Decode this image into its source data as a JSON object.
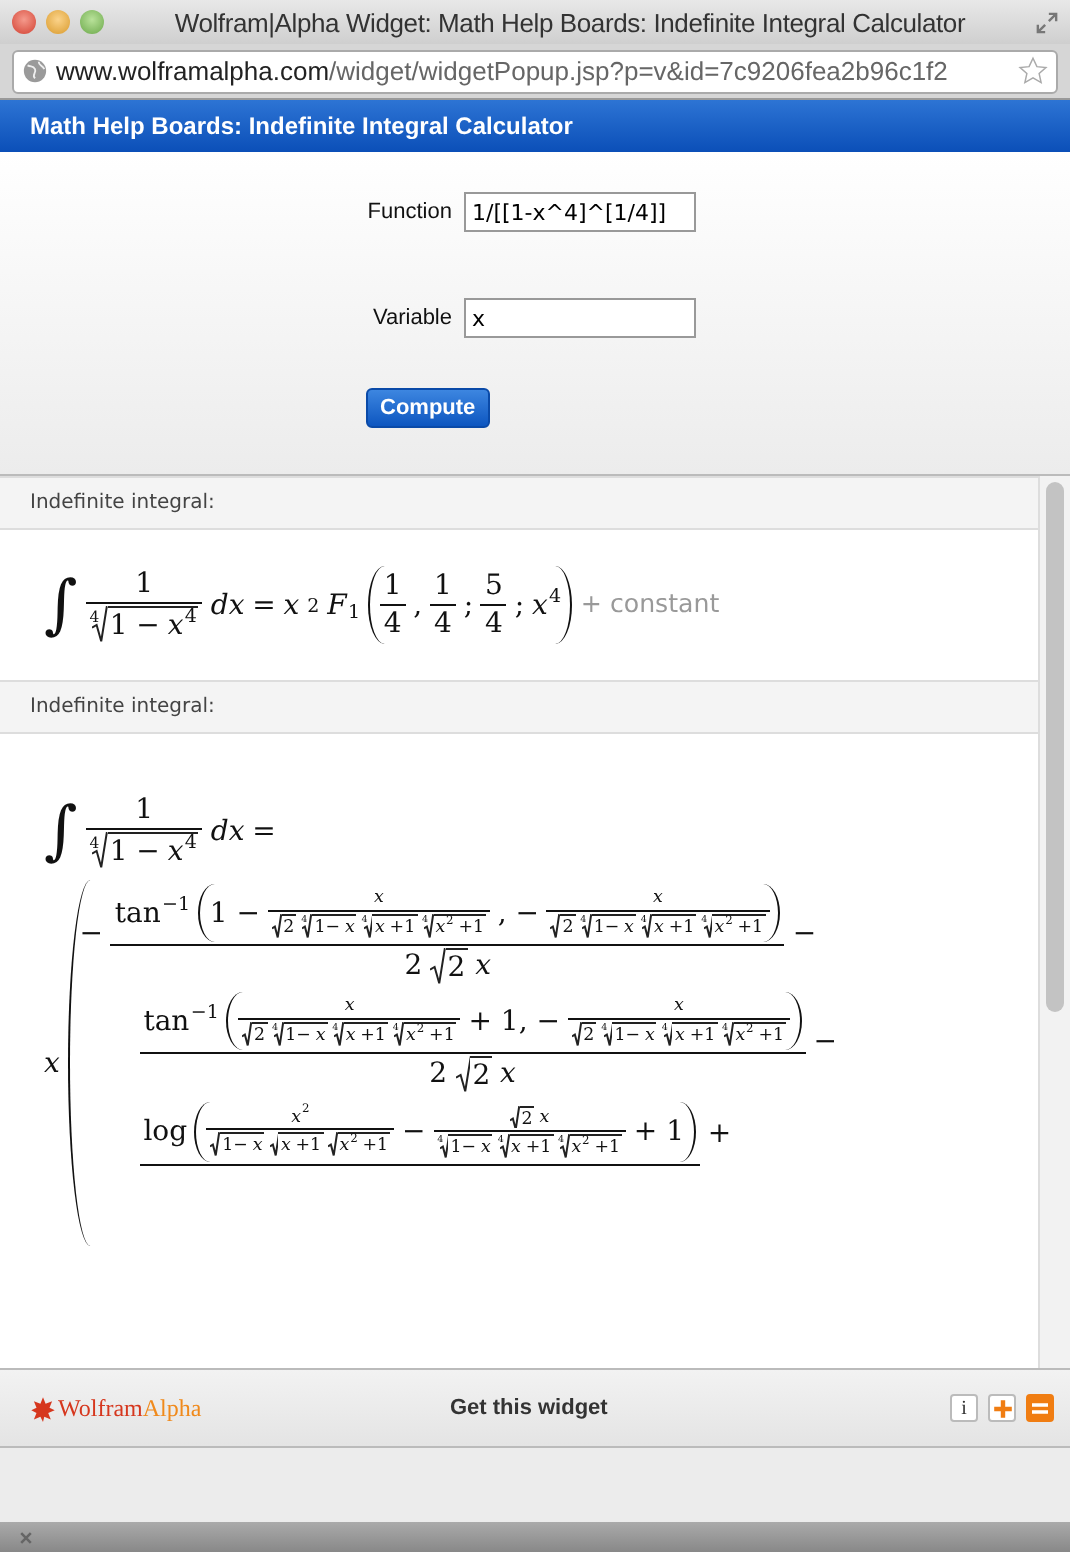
{
  "window": {
    "title": "Wolfram|Alpha Widget: Math Help Boards: Indefinite Integral Calculator"
  },
  "address_bar": {
    "host": "www.wolframalpha.com",
    "path": "/widget/widgetPopup.jsp?p=v&id=7c9206fea2b96c1f2"
  },
  "widget_header": "Math Help Boards: Indefinite Integral Calculator",
  "form": {
    "fields": [
      {
        "label": "Function",
        "value": "1/[[1-x^4]^[1/4]]"
      },
      {
        "label": "Variable",
        "value": "x"
      }
    ],
    "button": "Compute"
  },
  "pods": [
    {
      "title": "Indefinite integral:",
      "lines": [
        {
          "kind": "row",
          "items": [
            {
              "kind": "int",
              "text": "∫"
            },
            {
              "kind": "frac",
              "numerator": {
                "kind": "num",
                "text": "1"
              },
              "denominator": {
                "kind": "root",
                "index": "4",
                "radicand": {
                  "kind": "row",
                  "items": [
                    {
                      "kind": "num",
                      "text": "1 −"
                    },
                    {
                      "kind": "sup",
                      "base": {
                        "kind": "var",
                        "text": "x"
                      },
                      "script": {
                        "kind": "num",
                        "text": "4"
                      }
                    }
                  ]
                }
              }
            },
            {
              "kind": "var",
              "text": "dx"
            },
            {
              "kind": "num",
              "text": "="
            },
            {
              "kind": "var",
              "text": "x"
            },
            {
              "kind": "row",
              "items": [
                {
                  "kind": "sub",
                  "script": {
                    "kind": "num",
                    "text": "2"
                  }
                },
                {
                  "kind": "sub",
                  "base": {
                    "kind": "var",
                    "text": "F"
                  },
                  "script": {
                    "kind": "num",
                    "text": "1"
                  }
                }
              ]
            },
            {
              "kind": "paren",
              "content": {
                "kind": "row",
                "items": [
                  {
                    "kind": "frac",
                    "numerator": {
                      "kind": "num",
                      "text": "1"
                    },
                    "denominator": {
                      "kind": "num",
                      "text": "4"
                    }
                  },
                  {
                    "kind": "num",
                    "text": ","
                  },
                  {
                    "kind": "frac",
                    "numerator": {
                      "kind": "num",
                      "text": "1"
                    },
                    "denominator": {
                      "kind": "num",
                      "text": "4"
                    }
                  },
                  {
                    "kind": "num",
                    "text": ";"
                  },
                  {
                    "kind": "frac",
                    "numerator": {
                      "kind": "num",
                      "text": "5"
                    },
                    "denominator": {
                      "kind": "num",
                      "text": "4"
                    }
                  },
                  {
                    "kind": "num",
                    "text": ";"
                  },
                  {
                    "kind": "sup",
                    "base": {
                      "kind": "var",
                      "text": "x"
                    },
                    "script": {
                      "kind": "num",
                      "text": "4"
                    }
                  }
                ]
              }
            },
            {
              "kind": "note",
              "text": "+ constant"
            }
          ]
        }
      ]
    },
    {
      "title": "Indefinite integral:",
      "lines": [
        {
          "kind": "row",
          "items": [
            {
              "kind": "int",
              "text": "∫"
            },
            {
              "kind": "frac",
              "numerator": {
                "kind": "num",
                "text": "1"
              },
              "denominator": {
                "kind": "root",
                "index": "4",
                "radicand": {
                  "kind": "row",
                  "items": [
                    {
                      "kind": "num",
                      "text": "1 −"
                    },
                    {
                      "kind": "sup",
                      "base": {
                        "kind": "var",
                        "text": "x"
                      },
                      "script": {
                        "kind": "num",
                        "text": "4"
                      }
                    }
                  ]
                }
              }
            },
            {
              "kind": "var",
              "text": "dx"
            },
            {
              "kind": "num",
              "text": "="
            }
          ]
        },
        {
          "kind": "row",
          "items": [
            {
              "kind": "var",
              "text": "x"
            },
            {
              "kind": "open_paren",
              "content": {
                "kind": "col",
                "items": [
                  {
                    "kind": "row",
                    "items": [
                      {
                        "kind": "num",
                        "text": "−"
                      },
                      {
                        "kind": "frac",
                        "numerator": {
                          "kind": "row",
                          "items": [
                            {
                              "kind": "sup",
                              "base": {
                                "kind": "num",
                                "text": "tan"
                              },
                              "script": {
                                "kind": "num",
                                "text": "−1"
                              }
                            },
                            {
                              "kind": "paren",
                              "content": {
                                "kind": "row",
                                "items": [
                                  {
                                    "kind": "num",
                                    "text": "1 −"
                                  },
                                  {
                                    "kind": "frac",
                                    "numerator": {
                                      "kind": "var",
                                      "text": "x"
                                    },
                                    "denominator": {
                                      "kind": "row",
                                      "items": [
                                        {
                                          "kind": "root",
                                          "radicand": {
                                            "kind": "num",
                                            "text": "2"
                                          }
                                        },
                                        {
                                          "kind": "root",
                                          "index": "4",
                                          "radicand": {
                                            "kind": "row",
                                            "items": [
                                              {
                                                "kind": "num",
                                                "text": "1−"
                                              },
                                              {
                                                "kind": "var",
                                                "text": "x"
                                              }
                                            ]
                                          }
                                        },
                                        {
                                          "kind": "root",
                                          "index": "4",
                                          "radicand": {
                                            "kind": "row",
                                            "items": [
                                              {
                                                "kind": "var",
                                                "text": "x"
                                              },
                                              {
                                                "kind": "num",
                                                "text": "+1"
                                              }
                                            ]
                                          }
                                        },
                                        {
                                          "kind": "root",
                                          "index": "4",
                                          "radicand": {
                                            "kind": "row",
                                            "items": [
                                              {
                                                "kind": "sup",
                                                "base": {
                                                  "kind": "var",
                                                  "text": "x"
                                                },
                                                "script": {
                                                  "kind": "num",
                                                  "text": "2"
                                                }
                                              },
                                              {
                                                "kind": "num",
                                                "text": "+1"
                                              }
                                            ]
                                          }
                                        }
                                      ]
                                    }
                                  },
                                  {
                                    "kind": "num",
                                    "text": ", −"
                                  },
                                  {
                                    "kind": "frac",
                                    "numerator": {
                                      "kind": "var",
                                      "text": "x"
                                    },
                                    "denominator": {
                                      "kind": "row",
                                      "items": [
                                        {
                                          "kind": "root",
                                          "radicand": {
                                            "kind": "num",
                                            "text": "2"
                                          }
                                        },
                                        {
                                          "kind": "root",
                                          "index": "4",
                                          "radicand": {
                                            "kind": "row",
                                            "items": [
                                              {
                                                "kind": "num",
                                                "text": "1−"
                                              },
                                              {
                                                "kind": "var",
                                                "text": "x"
                                              }
                                            ]
                                          }
                                        },
                                        {
                                          "kind": "root",
                                          "index": "4",
                                          "radicand": {
                                            "kind": "row",
                                            "items": [
                                              {
                                                "kind": "var",
                                                "text": "x"
                                              },
                                              {
                                                "kind": "num",
                                                "text": "+1"
                                              }
                                            ]
                                          }
                                        },
                                        {
                                          "kind": "root",
                                          "index": "4",
                                          "radicand": {
                                            "kind": "row",
                                            "items": [
                                              {
                                                "kind": "sup",
                                                "base": {
                                                  "kind": "var",
                                                  "text": "x"
                                                },
                                                "script": {
                                                  "kind": "num",
                                                  "text": "2"
                                                }
                                              },
                                              {
                                                "kind": "num",
                                                "text": "+1"
                                              }
                                            ]
                                          }
                                        }
                                      ]
                                    }
                                  }
                                ]
                              }
                            }
                          ]
                        },
                        "denominator": {
                          "kind": "row",
                          "items": [
                            {
                              "kind": "num",
                              "text": "2"
                            },
                            {
                              "kind": "root",
                              "radicand": {
                                "kind": "num",
                                "text": "2"
                              }
                            },
                            {
                              "kind": "var",
                              "text": "x"
                            }
                          ]
                        }
                      },
                      {
                        "kind": "num",
                        "text": "−"
                      }
                    ]
                  },
                  {
                    "kind": "row",
                    "items": [
                      {
                        "kind": "frac",
                        "numerator": {
                          "kind": "row",
                          "items": [
                            {
                              "kind": "sup",
                              "base": {
                                "kind": "num",
                                "text": "tan"
                              },
                              "script": {
                                "kind": "num",
                                "text": "−1"
                              }
                            },
                            {
                              "kind": "paren",
                              "content": {
                                "kind": "row",
                                "items": [
                                  {
                                    "kind": "frac",
                                    "numerator": {
                                      "kind": "var",
                                      "text": "x"
                                    },
                                    "denominator": {
                                      "kind": "row",
                                      "items": [
                                        {
                                          "kind": "root",
                                          "radicand": {
                                            "kind": "num",
                                            "text": "2"
                                          }
                                        },
                                        {
                                          "kind": "root",
                                          "index": "4",
                                          "radicand": {
                                            "kind": "row",
                                            "items": [
                                              {
                                                "kind": "num",
                                                "text": "1−"
                                              },
                                              {
                                                "kind": "var",
                                                "text": "x"
                                              }
                                            ]
                                          }
                                        },
                                        {
                                          "kind": "root",
                                          "index": "4",
                                          "radicand": {
                                            "kind": "row",
                                            "items": [
                                              {
                                                "kind": "var",
                                                "text": "x"
                                              },
                                              {
                                                "kind": "num",
                                                "text": "+1"
                                              }
                                            ]
                                          }
                                        },
                                        {
                                          "kind": "root",
                                          "index": "4",
                                          "radicand": {
                                            "kind": "row",
                                            "items": [
                                              {
                                                "kind": "sup",
                                                "base": {
                                                  "kind": "var",
                                                  "text": "x"
                                                },
                                                "script": {
                                                  "kind": "num",
                                                  "text": "2"
                                                }
                                              },
                                              {
                                                "kind": "num",
                                                "text": "+1"
                                              }
                                            ]
                                          }
                                        }
                                      ]
                                    }
                                  },
                                  {
                                    "kind": "num",
                                    "text": "+ 1, −"
                                  },
                                  {
                                    "kind": "frac",
                                    "numerator": {
                                      "kind": "var",
                                      "text": "x"
                                    },
                                    "denominator": {
                                      "kind": "row",
                                      "items": [
                                        {
                                          "kind": "root",
                                          "radicand": {
                                            "kind": "num",
                                            "text": "2"
                                          }
                                        },
                                        {
                                          "kind": "root",
                                          "index": "4",
                                          "radicand": {
                                            "kind": "row",
                                            "items": [
                                              {
                                                "kind": "num",
                                                "text": "1−"
                                              },
                                              {
                                                "kind": "var",
                                                "text": "x"
                                              }
                                            ]
                                          }
                                        },
                                        {
                                          "kind": "root",
                                          "index": "4",
                                          "radicand": {
                                            "kind": "row",
                                            "items": [
                                              {
                                                "kind": "var",
                                                "text": "x"
                                              },
                                              {
                                                "kind": "num",
                                                "text": "+1"
                                              }
                                            ]
                                          }
                                        },
                                        {
                                          "kind": "root",
                                          "index": "4",
                                          "radicand": {
                                            "kind": "row",
                                            "items": [
                                              {
                                                "kind": "sup",
                                                "base": {
                                                  "kind": "var",
                                                  "text": "x"
                                                },
                                                "script": {
                                                  "kind": "num",
                                                  "text": "2"
                                                }
                                              },
                                              {
                                                "kind": "num",
                                                "text": "+1"
                                              }
                                            ]
                                          }
                                        }
                                      ]
                                    }
                                  }
                                ]
                              }
                            }
                          ]
                        },
                        "denominator": {
                          "kind": "row",
                          "items": [
                            {
                              "kind": "num",
                              "text": "2"
                            },
                            {
                              "kind": "root",
                              "radicand": {
                                "kind": "num",
                                "text": "2"
                              }
                            },
                            {
                              "kind": "var",
                              "text": "x"
                            }
                          ]
                        }
                      },
                      {
                        "kind": "num",
                        "text": "−"
                      }
                    ]
                  },
                  {
                    "kind": "row",
                    "items": [
                      {
                        "kind": "frac",
                        "numerator": {
                          "kind": "row",
                          "items": [
                            {
                              "kind": "num",
                              "text": "log"
                            },
                            {
                              "kind": "paren",
                              "content": {
                                "kind": "row",
                                "items": [
                                  {
                                    "kind": "frac",
                                    "numerator": {
                                      "kind": "sup",
                                      "base": {
                                        "kind": "var",
                                        "text": "x"
                                      },
                                      "script": {
                                        "kind": "num",
                                        "text": "2"
                                      }
                                    },
                                    "denominator": {
                                      "kind": "row",
                                      "items": [
                                        {
                                          "kind": "root",
                                          "radicand": {
                                            "kind": "row",
                                            "items": [
                                              {
                                                "kind": "num",
                                                "text": "1−"
                                              },
                                              {
                                                "kind": "var",
                                                "text": "x"
                                              }
                                            ]
                                          }
                                        },
                                        {
                                          "kind": "root",
                                          "radicand": {
                                            "kind": "row",
                                            "items": [
                                              {
                                                "kind": "var",
                                                "text": "x"
                                              },
                                              {
                                                "kind": "num",
                                                "text": "+1"
                                              }
                                            ]
                                          }
                                        },
                                        {
                                          "kind": "root",
                                          "radicand": {
                                            "kind": "row",
                                            "items": [
                                              {
                                                "kind": "sup",
                                                "base": {
                                                  "kind": "var",
                                                  "text": "x"
                                                },
                                                "script": {
                                                  "kind": "num",
                                                  "text": "2"
                                                }
                                              },
                                              {
                                                "kind": "num",
                                                "text": "+1"
                                              }
                                            ]
                                          }
                                        }
                                      ]
                                    }
                                  },
                                  {
                                    "kind": "num",
                                    "text": "−"
                                  },
                                  {
                                    "kind": "frac",
                                    "numerator": {
                                      "kind": "row",
                                      "items": [
                                        {
                                          "kind": "root",
                                          "radicand": {
                                            "kind": "num",
                                            "text": "2"
                                          }
                                        },
                                        {
                                          "kind": "var",
                                          "text": "x"
                                        }
                                      ]
                                    },
                                    "denominator": {
                                      "kind": "row",
                                      "items": [
                                        {
                                          "kind": "root",
                                          "index": "4",
                                          "radicand": {
                                            "kind": "row",
                                            "items": [
                                              {
                                                "kind": "num",
                                                "text": "1−"
                                              },
                                              {
                                                "kind": "var",
                                                "text": "x"
                                              }
                                            ]
                                          }
                                        },
                                        {
                                          "kind": "root",
                                          "index": "4",
                                          "radicand": {
                                            "kind": "row",
                                            "items": [
                                              {
                                                "kind": "var",
                                                "text": "x"
                                              },
                                              {
                                                "kind": "num",
                                                "text": "+1"
                                              }
                                            ]
                                          }
                                        },
                                        {
                                          "kind": "root",
                                          "index": "4",
                                          "radicand": {
                                            "kind": "row",
                                            "items": [
                                              {
                                                "kind": "sup",
                                                "base": {
                                                  "kind": "var",
                                                  "text": "x"
                                                },
                                                "script": {
                                                  "kind": "num",
                                                  "text": "2"
                                                }
                                              },
                                              {
                                                "kind": "num",
                                                "text": "+1"
                                              }
                                            ]
                                          }
                                        }
                                      ]
                                    }
                                  },
                                  {
                                    "kind": "num",
                                    "text": "+ 1"
                                  }
                                ]
                              }
                            }
                          ]
                        }
                      },
                      {
                        "kind": "num",
                        "text": "+"
                      }
                    ]
                  }
                ]
              }
            }
          ]
        }
      ]
    }
  ],
  "footer": {
    "logo": [
      "Wolfram",
      "Alpha"
    ],
    "link": "Get this widget",
    "info_button": "i"
  }
}
